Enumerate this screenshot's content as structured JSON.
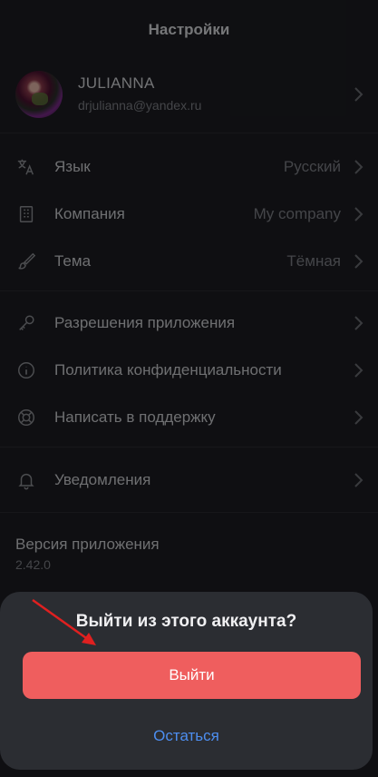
{
  "header": {
    "title": "Настройки"
  },
  "profile": {
    "name": "JULIANNA",
    "email": "drjulianna@yandex.ru"
  },
  "settings_group1": [
    {
      "label": "Язык",
      "value": "Русский",
      "icon": "translate-icon"
    },
    {
      "label": "Компания",
      "value": "My company",
      "icon": "building-icon"
    },
    {
      "label": "Тема",
      "value": "Тёмная",
      "icon": "brush-icon"
    }
  ],
  "settings_group2": [
    {
      "label": "Разрешения приложения",
      "icon": "key-icon"
    },
    {
      "label": "Политика конфиденциальности",
      "icon": "info-icon"
    },
    {
      "label": "Написать в поддержку",
      "icon": "lifebuoy-icon"
    }
  ],
  "settings_group3": [
    {
      "label": "Уведомления",
      "icon": "bell-icon"
    }
  ],
  "version": {
    "title": "Версия приложения",
    "number": "2.42.0"
  },
  "logout_sheet": {
    "question": "Выйти из этого аккаунта?",
    "confirm_label": "Выйти",
    "cancel_label": "Остаться"
  },
  "colors": {
    "danger": "#ef5e5e",
    "link": "#4d8ef0",
    "annotation_arrow": "#e02020"
  }
}
